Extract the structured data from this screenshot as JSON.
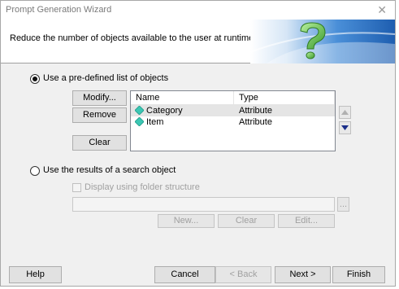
{
  "window": {
    "title": "Prompt Generation Wizard",
    "close_symbol": "✕"
  },
  "header": {
    "text": "Reduce the number of objects available to the user at runtime."
  },
  "options": {
    "predefined_label": "Use a pre-defined list of objects",
    "predefined_selected": true,
    "search_label": "Use the results of a search object",
    "search_selected": false
  },
  "list_buttons": {
    "modify": "Modify...",
    "remove": "Remove",
    "clear": "Clear"
  },
  "list": {
    "columns": [
      "Name",
      "Type"
    ],
    "rows": [
      {
        "name": "Category",
        "type": "Attribute",
        "icon": "attribute-icon",
        "selected": true
      },
      {
        "name": "Item",
        "type": "Attribute",
        "icon": "attribute-icon",
        "selected": false
      }
    ]
  },
  "search": {
    "folder_checkbox_label": "Display using folder structure",
    "folder_checked": false,
    "search_object_value": "",
    "browse_label": "...",
    "new_label": "New...",
    "clear_label": "Clear",
    "edit_label": "Edit..."
  },
  "footer": {
    "help": "Help",
    "cancel": "Cancel",
    "back": "< Back",
    "next": "Next >",
    "finish": "Finish"
  },
  "colors": {
    "icon_teal": "#3cc7b4",
    "header_blue": "#2e74c4",
    "question_green": "#5ac24a"
  }
}
